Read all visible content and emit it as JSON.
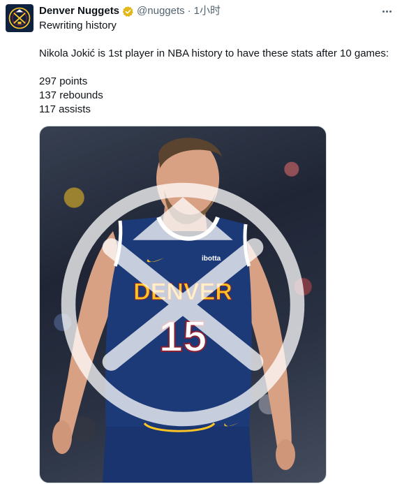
{
  "tweet": {
    "author": {
      "display_name": "Denver Nuggets",
      "handle": "@nuggets",
      "separator": "·",
      "timestamp": "1小时"
    },
    "text_lines": [
      "Rewriting history",
      "Nikola Jokić is 1st player in NBA history to have these stats after 10 games:",
      "297 points",
      "137 rebounds",
      "117 assists"
    ],
    "media": {
      "jersey_wordmark": "DENVER",
      "jersey_number": "15",
      "jersey_sponsor": "ibotta"
    }
  },
  "colors": {
    "nuggets_navy": "#0e2240",
    "jersey_blue": "#1d3a78",
    "nuggets_gold": "#fec524",
    "verified_gold": "#e2b719",
    "muted_text": "#536471"
  },
  "icons": {
    "avatar": "nuggets-logo-icon",
    "verified": "verified-badge-icon",
    "more": "more-options-icon",
    "watermark": "nuggets-logo-icon"
  }
}
